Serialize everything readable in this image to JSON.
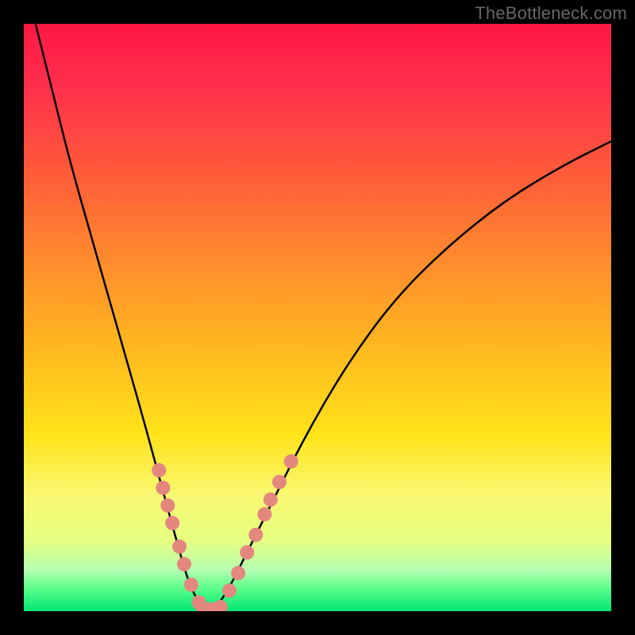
{
  "watermark": "TheBottleneck.com",
  "chart_data": {
    "type": "line",
    "title": "",
    "xlabel": "",
    "ylabel": "",
    "xlim": [
      0,
      100
    ],
    "ylim": [
      0,
      100
    ],
    "grid": false,
    "legend": false,
    "series": [
      {
        "name": "bottleneck-curve",
        "color": "#000000",
        "x": [
          2,
          5,
          8,
          12,
          16,
          20,
          23,
          26,
          28,
          30,
          31,
          32,
          33,
          35,
          38,
          42,
          48,
          55,
          63,
          72,
          82,
          92,
          100
        ],
        "y": [
          100,
          88,
          76,
          62,
          48,
          34,
          23,
          12,
          5,
          1,
          0,
          0,
          1,
          4,
          10,
          18,
          30,
          42,
          53,
          62,
          70,
          76,
          80
        ]
      }
    ],
    "markers": [
      {
        "name": "left-cluster",
        "color": "#e4877f",
        "points": [
          {
            "x": 23,
            "y": 24
          },
          {
            "x": 23.7,
            "y": 21
          },
          {
            "x": 24.5,
            "y": 18
          },
          {
            "x": 25.3,
            "y": 15
          },
          {
            "x": 26.5,
            "y": 11
          },
          {
            "x": 27.3,
            "y": 8
          },
          {
            "x": 28.5,
            "y": 4.5
          },
          {
            "x": 29.8,
            "y": 1.5
          }
        ]
      },
      {
        "name": "bottom-cluster",
        "color": "#e4877f",
        "points": [
          {
            "x": 30.5,
            "y": 0.5
          },
          {
            "x": 31.5,
            "y": 0.3
          },
          {
            "x": 32.5,
            "y": 0.3
          },
          {
            "x": 33.5,
            "y": 0.7
          }
        ]
      },
      {
        "name": "right-cluster",
        "color": "#e4877f",
        "points": [
          {
            "x": 35,
            "y": 3.5
          },
          {
            "x": 36.5,
            "y": 6.5
          },
          {
            "x": 38,
            "y": 10
          },
          {
            "x": 39.5,
            "y": 13
          },
          {
            "x": 41,
            "y": 16.5
          },
          {
            "x": 42,
            "y": 19
          },
          {
            "x": 43.5,
            "y": 22
          },
          {
            "x": 45.5,
            "y": 25.5
          }
        ]
      }
    ]
  }
}
